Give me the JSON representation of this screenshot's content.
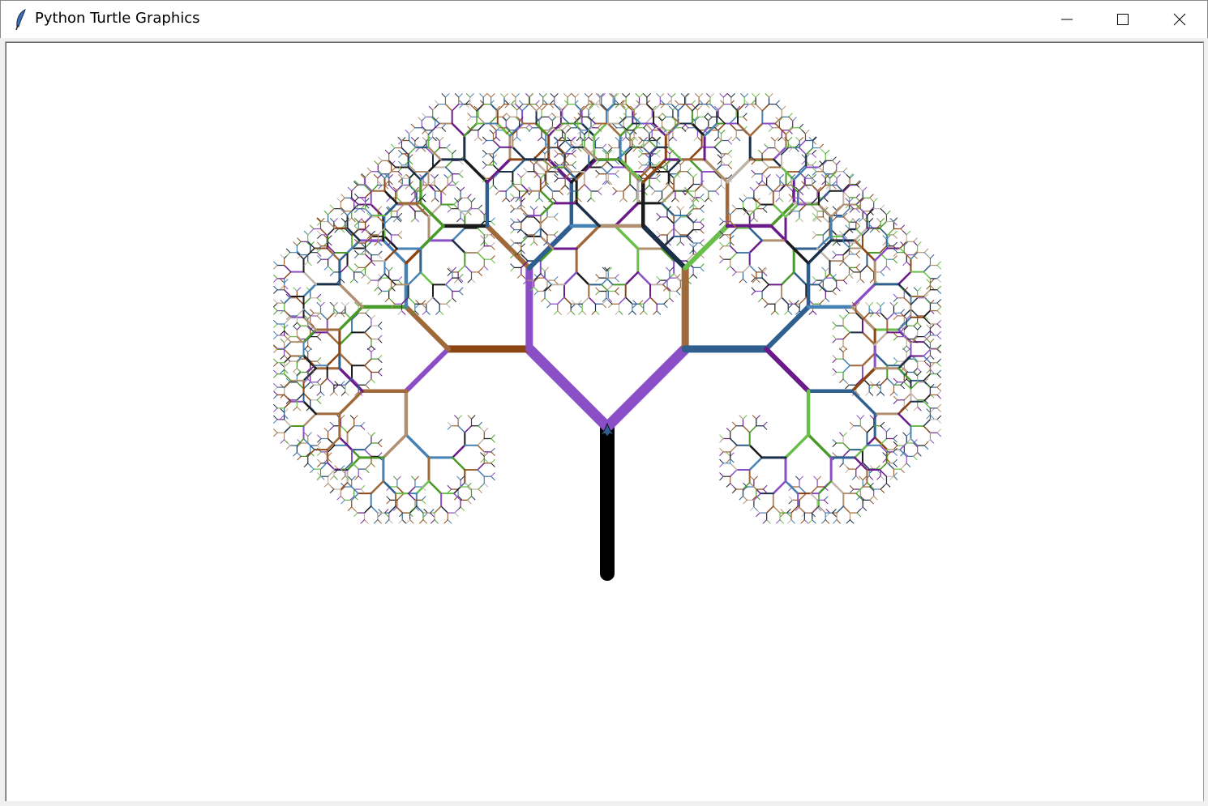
{
  "window": {
    "title": "Python Turtle Graphics",
    "controls": [
      "minimize",
      "maximize",
      "close"
    ]
  },
  "canvas": {
    "background": "#ffffff",
    "drawing": "fractal-tree",
    "trunk_color": "#000000",
    "palette": [
      "#1b2f4a",
      "#2e5f8e",
      "#6b1a8a",
      "#8b4513",
      "#c0b4a8",
      "#4a9a2a",
      "#6abf4a",
      "#8a4fc6",
      "#4682b4",
      "#a0693a",
      "#1a1a1a",
      "#b09070"
    ],
    "turtle_shape": "turtle",
    "turtle_color": "#2e5f8e"
  }
}
